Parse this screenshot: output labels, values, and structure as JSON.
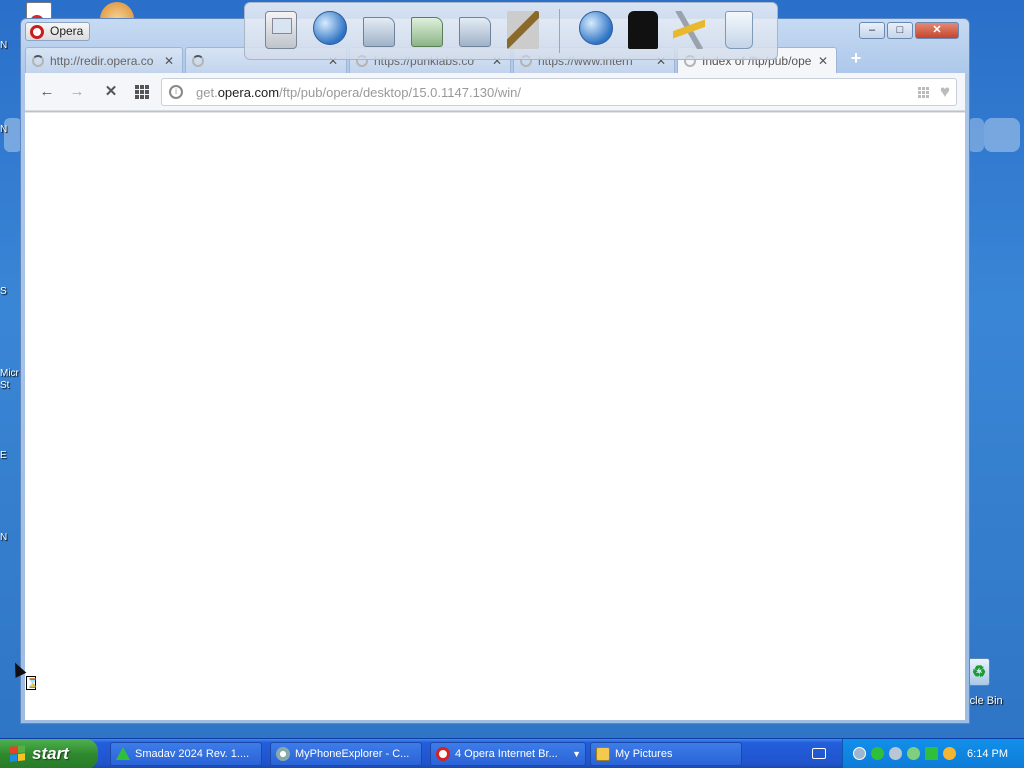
{
  "desktop": {
    "left_labels": [
      "N",
      "N",
      "S",
      "Micr",
      "St",
      "E",
      "N"
    ],
    "recycle_bin_label": "rcle Bin"
  },
  "window": {
    "app_button_label": "Opera",
    "controls": {
      "minimize": "–",
      "maximize": "□",
      "close": "✕"
    }
  },
  "tabs": [
    {
      "label": "http://redir.opera.co",
      "loading": true,
      "active": false
    },
    {
      "label": "",
      "loading": true,
      "active": false
    },
    {
      "label": "https://punklabs.co",
      "loading": true,
      "active": false
    },
    {
      "label": "https://www.intern",
      "loading": true,
      "active": false
    },
    {
      "label": "Index of /ftp/pub/ope",
      "loading": true,
      "active": true
    }
  ],
  "toolbar": {
    "back": "←",
    "forward": "→",
    "stop": "✕",
    "address": {
      "prefix": "get.",
      "host": "opera.com",
      "path": "/ftp/pub/opera/desktop/15.0.1147.130/win/"
    },
    "heart": "♥",
    "new_tab": "+"
  },
  "dock": {
    "icons": [
      "monitor-icon",
      "globe-icon",
      "folder-icon",
      "folder-green-icon",
      "folder-disk-icon",
      "tools-icon",
      "network-globe-icon",
      "shirt-icon",
      "hammer-icon",
      "recycle-bin-icon"
    ]
  },
  "taskbar": {
    "start_label": "start",
    "tasks": [
      {
        "label": "Smadav 2024 Rev. 1....",
        "icon": "smadav-icon"
      },
      {
        "label": "MyPhoneExplorer - C...",
        "icon": "myphoneexplorer-icon"
      },
      {
        "label": "4 Opera Internet Br...",
        "icon": "opera-icon"
      },
      {
        "label": "My Pictures",
        "icon": "folder-icon"
      }
    ],
    "clock": "6:14 PM"
  },
  "colors": {
    "desktop": "#2f74c4",
    "taskbar": "#245edb",
    "start": "#2f8a2f",
    "tray": "#0d7bd8"
  }
}
